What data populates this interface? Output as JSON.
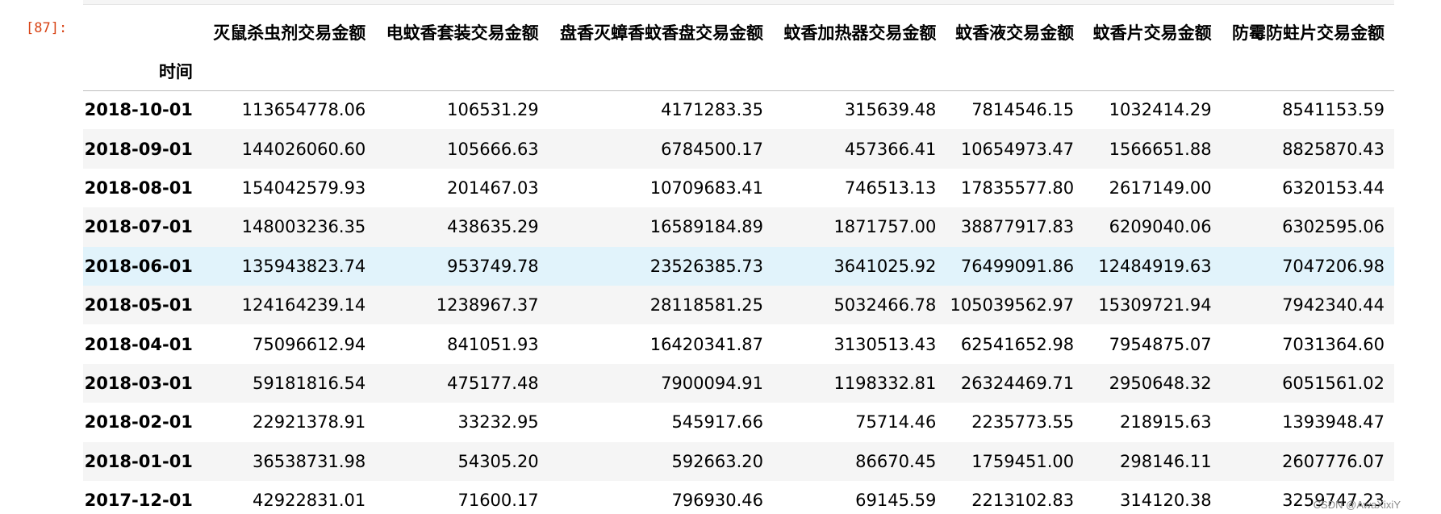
{
  "cell": {
    "prompt": "[87]:"
  },
  "table": {
    "index_name": "时间",
    "columns": [
      "灭鼠杀虫剂交易金额",
      "电蚊香套装交易金额",
      "盘香灭蟑香蚊香盘交易金额",
      "蚊香加热器交易金额",
      "蚊香液交易金额",
      "蚊香片交易金额",
      "防霉防蛀片交易金额"
    ],
    "rows": [
      {
        "index": "2018-10-01",
        "values": [
          "113654778.06",
          "106531.29",
          "4171283.35",
          "315639.48",
          "7814546.15",
          "1032414.29",
          "8541153.59"
        ]
      },
      {
        "index": "2018-09-01",
        "values": [
          "144026060.60",
          "105666.63",
          "6784500.17",
          "457366.41",
          "10654973.47",
          "1566651.88",
          "8825870.43"
        ]
      },
      {
        "index": "2018-08-01",
        "values": [
          "154042579.93",
          "201467.03",
          "10709683.41",
          "746513.13",
          "17835577.80",
          "2617149.00",
          "6320153.44"
        ]
      },
      {
        "index": "2018-07-01",
        "values": [
          "148003236.35",
          "438635.29",
          "16589184.89",
          "1871757.00",
          "38877917.83",
          "6209040.06",
          "6302595.06"
        ]
      },
      {
        "index": "2018-06-01",
        "values": [
          "135943823.74",
          "953749.78",
          "23526385.73",
          "3641025.92",
          "76499091.86",
          "12484919.63",
          "7047206.98"
        ]
      },
      {
        "index": "2018-05-01",
        "values": [
          "124164239.14",
          "1238967.37",
          "28118581.25",
          "5032466.78",
          "105039562.97",
          "15309721.94",
          "7942340.44"
        ]
      },
      {
        "index": "2018-04-01",
        "values": [
          "75096612.94",
          "841051.93",
          "16420341.87",
          "3130513.43",
          "62541652.98",
          "7954875.07",
          "7031364.60"
        ]
      },
      {
        "index": "2018-03-01",
        "values": [
          "59181816.54",
          "475177.48",
          "7900094.91",
          "1198332.81",
          "26324469.71",
          "2950648.32",
          "6051561.02"
        ]
      },
      {
        "index": "2018-02-01",
        "values": [
          "22921378.91",
          "33232.95",
          "545917.66",
          "75714.46",
          "2235773.55",
          "218915.63",
          "1393948.47"
        ]
      },
      {
        "index": "2018-01-01",
        "values": [
          "36538731.98",
          "54305.20",
          "592663.20",
          "86670.45",
          "1759451.00",
          "298146.11",
          "2607776.07"
        ]
      },
      {
        "index": "2017-12-01",
        "values": [
          "42922831.01",
          "71600.17",
          "796930.46",
          "69145.59",
          "2213102.83",
          "314120.38",
          "3259747.23"
        ]
      }
    ],
    "highlighted_row": 4
  },
  "watermark": "CSDN @AwaXixiY"
}
